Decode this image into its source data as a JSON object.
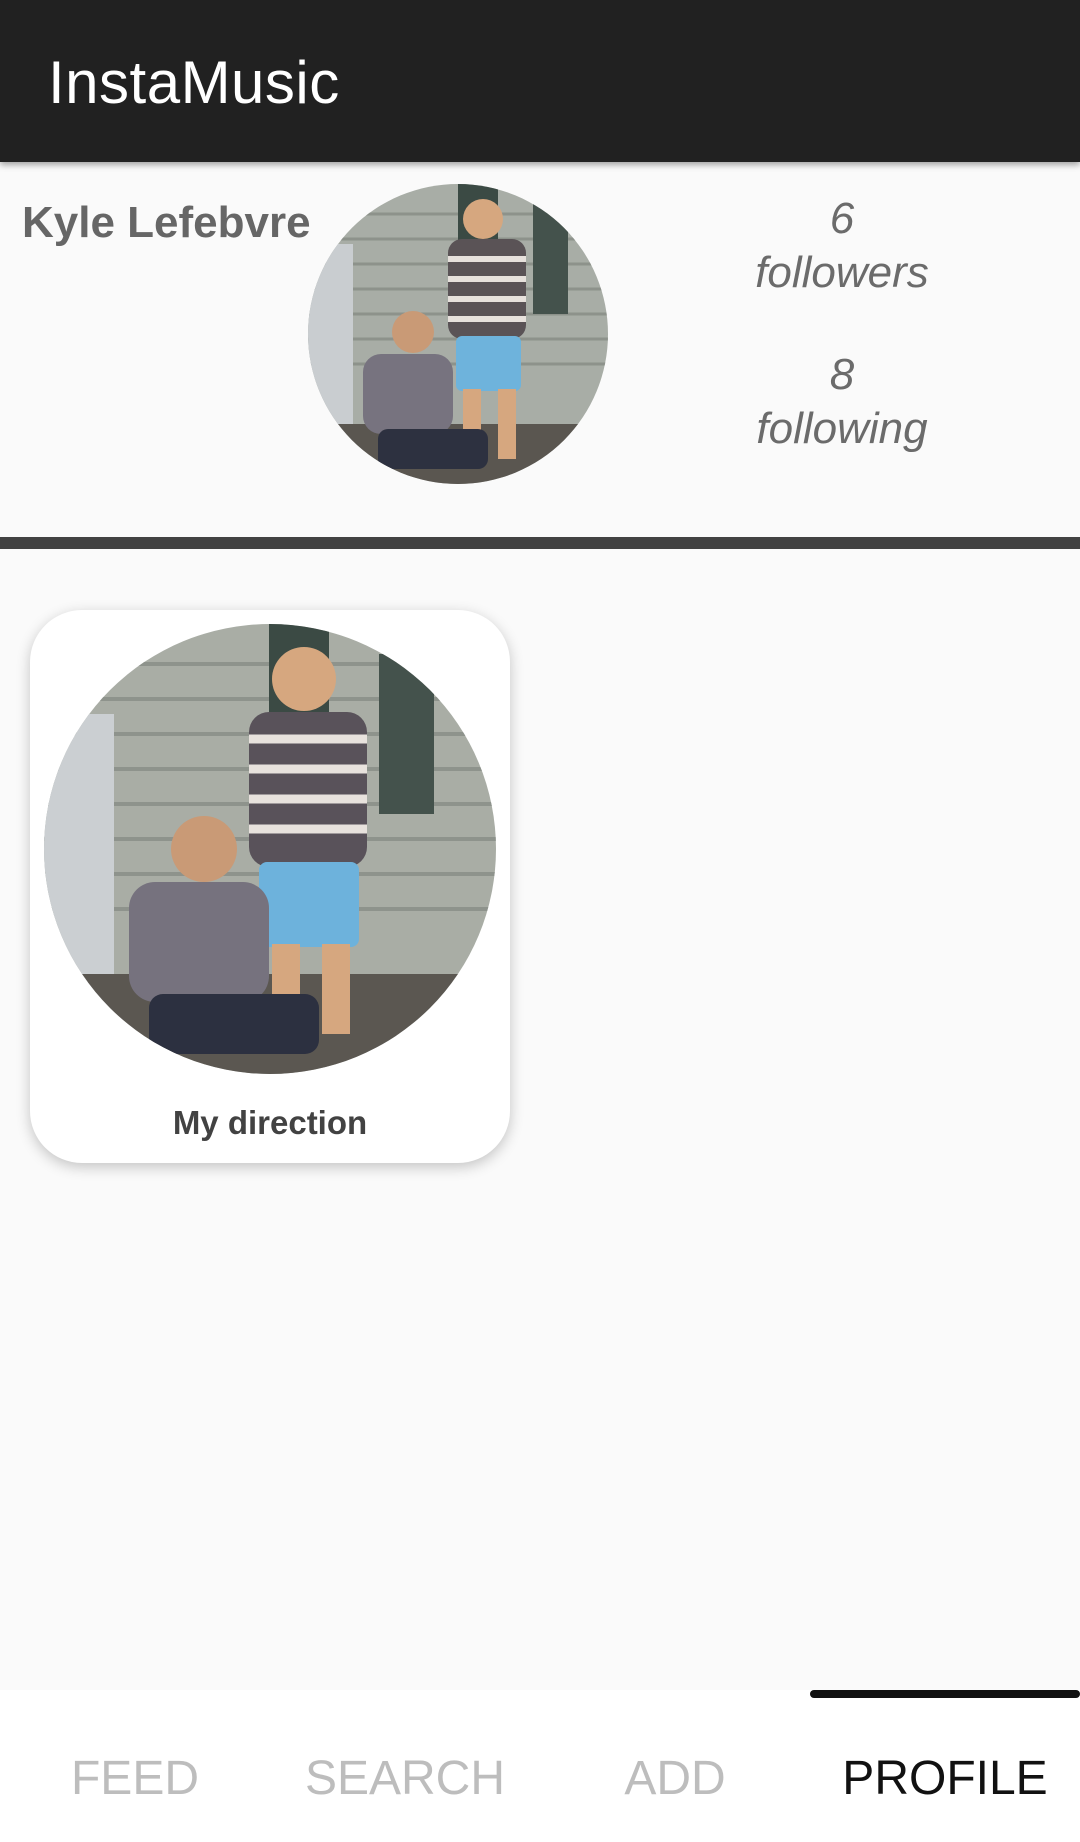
{
  "app_bar": {
    "title": "InstaMusic"
  },
  "profile": {
    "name": "Kyle Lefebvre",
    "avatar_icon": "profile-photo",
    "followers_count": "6",
    "followers_label": "followers",
    "following_count": "8",
    "following_label": "following"
  },
  "posts": [
    {
      "title": "My direction",
      "image_icon": "post-photo"
    }
  ],
  "bottom_nav": {
    "tabs": [
      {
        "label": "FEED",
        "active": false
      },
      {
        "label": "SEARCH",
        "active": false
      },
      {
        "label": "ADD",
        "active": false
      },
      {
        "label": "PROFILE",
        "active": true
      }
    ]
  },
  "colors": {
    "app_bar": "#212121",
    "background": "#fafafa",
    "divider": "#424242",
    "tab_inactive": "#bdbdbd",
    "tab_active": "#111111"
  }
}
